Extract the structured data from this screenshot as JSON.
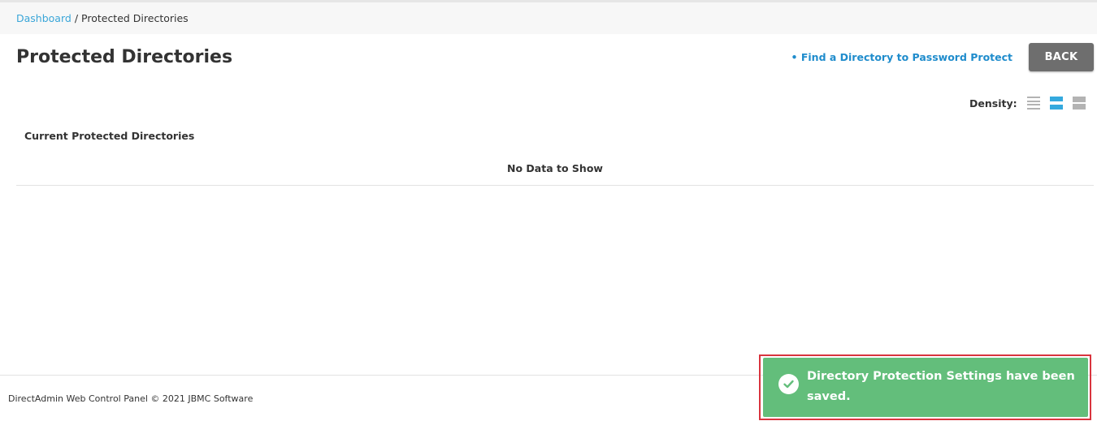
{
  "breadcrumb": {
    "home": "Dashboard",
    "separator": "/",
    "current": "Protected Directories"
  },
  "page": {
    "title": "Protected Directories",
    "find_link": "• Find a Directory to Password Protect",
    "back_label": "BACK"
  },
  "density": {
    "label": "Density:",
    "options": [
      "compact-icon",
      "regular-icon",
      "comfortable-icon"
    ],
    "selected": "regular-icon",
    "accent": "#34a9de"
  },
  "table": {
    "title": "Current Protected Directories",
    "empty_text": "No Data to Show"
  },
  "footer": {
    "text": "DirectAdmin Web Control Panel © 2021 JBMC Software"
  },
  "toast": {
    "message": "Directory Protection Settings have been saved.",
    "icon": "check-circle-icon",
    "color": "#63be7b",
    "outline_color": "#d9343e"
  }
}
